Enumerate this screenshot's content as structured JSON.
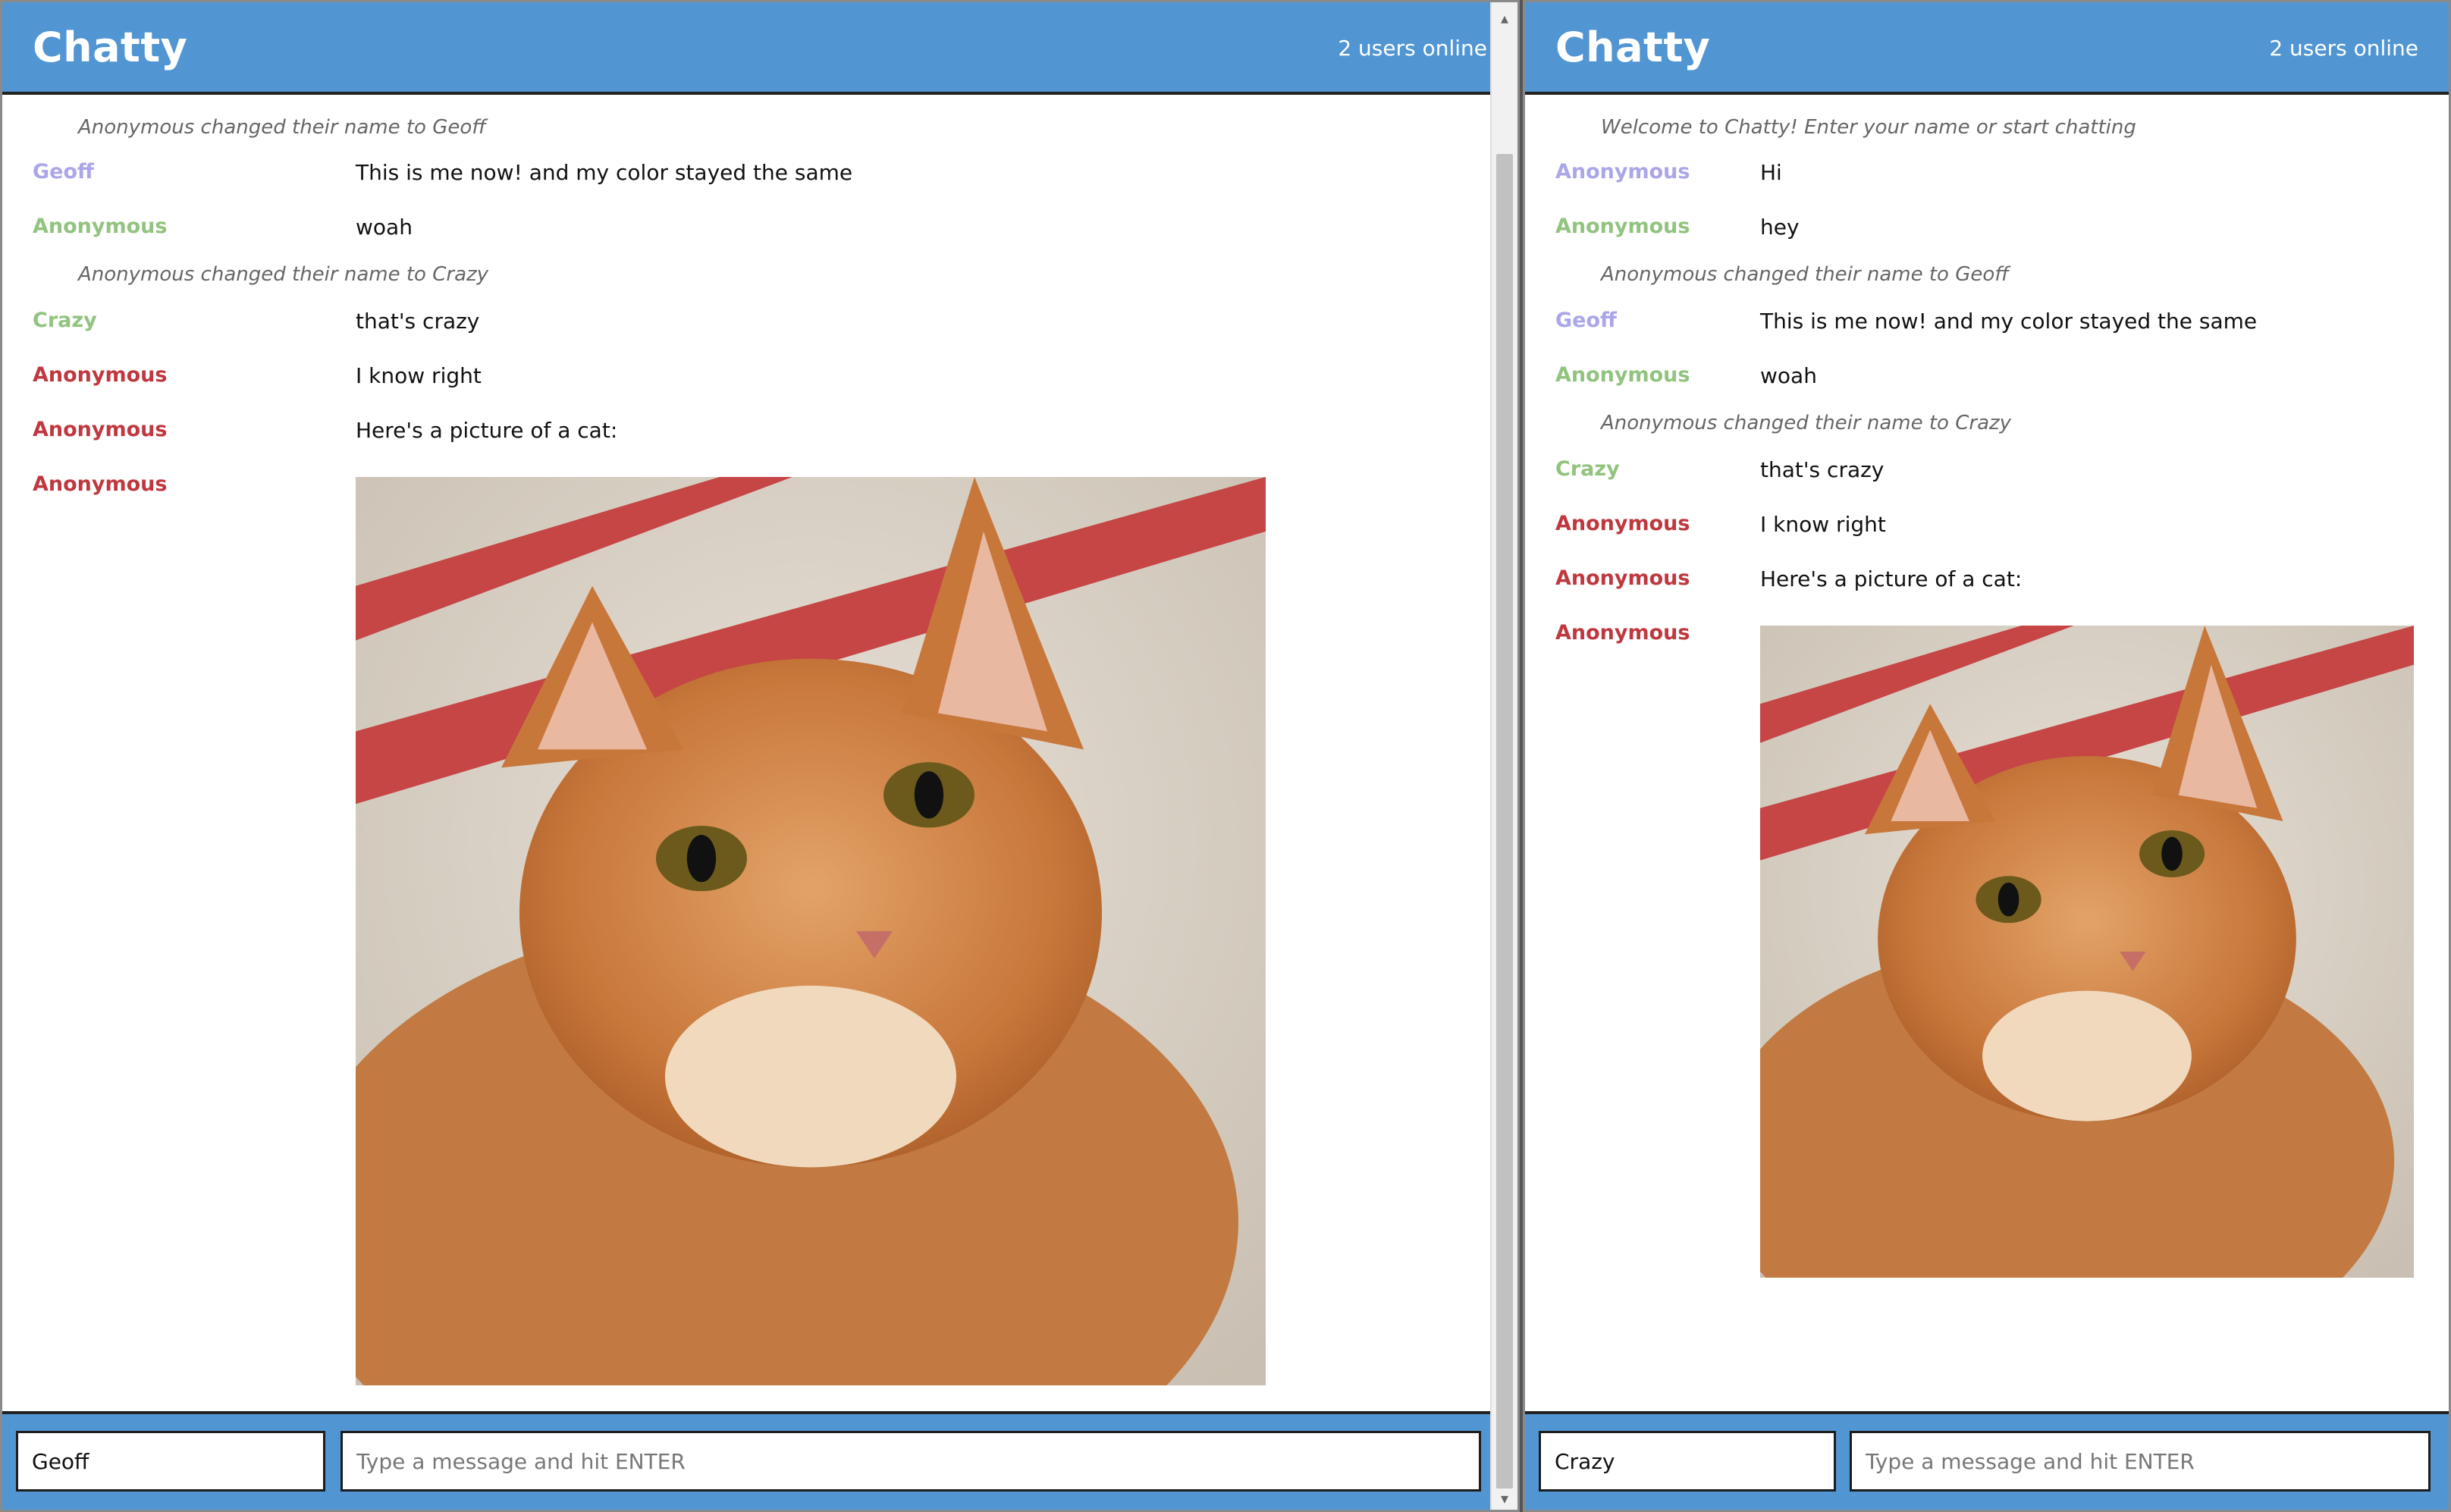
{
  "colors": {
    "header_bg": "#5196d3",
    "geoff": "#aaa6e8",
    "anonymous_green": "#92c37f",
    "anonymous_red": "#c0383f",
    "crazy": "#92c37f"
  },
  "left": {
    "title": "Chatty",
    "users_online": "2 users online",
    "messages": [
      {
        "type": "system",
        "text": "Anonymous changed their name to Geoff"
      },
      {
        "type": "user",
        "user": "Geoff",
        "color": "#aaa6e8",
        "text": "This is me now! and my color stayed the same"
      },
      {
        "type": "user",
        "user": "Anonymous",
        "color": "#92c37f",
        "text": "woah"
      },
      {
        "type": "system",
        "text": "Anonymous changed their name to Crazy"
      },
      {
        "type": "user",
        "user": "Crazy",
        "color": "#92c37f",
        "text": "that's crazy"
      },
      {
        "type": "user",
        "user": "Anonymous",
        "color": "#c0383f",
        "text": "I know right"
      },
      {
        "type": "user",
        "user": "Anonymous",
        "color": "#c0383f",
        "text": "Here's a picture of a cat:"
      },
      {
        "type": "image",
        "user": "Anonymous",
        "color": "#c0383f",
        "image": "orange-cat-photo"
      }
    ],
    "composer": {
      "name_value": "Geoff",
      "message_placeholder": "Type a message and hit ENTER"
    }
  },
  "right": {
    "title": "Chatty",
    "users_online": "2 users online",
    "messages": [
      {
        "type": "system",
        "text": "Welcome to Chatty! Enter your name or start chatting"
      },
      {
        "type": "user",
        "user": "Anonymous",
        "color": "#aaa6e8",
        "text": "Hi"
      },
      {
        "type": "user",
        "user": "Anonymous",
        "color": "#92c37f",
        "text": "hey"
      },
      {
        "type": "system",
        "text": "Anonymous changed their name to Geoff"
      },
      {
        "type": "user",
        "user": "Geoff",
        "color": "#aaa6e8",
        "text": "This is me now! and my color stayed the same"
      },
      {
        "type": "user",
        "user": "Anonymous",
        "color": "#92c37f",
        "text": "woah"
      },
      {
        "type": "system",
        "text": "Anonymous changed their name to Crazy"
      },
      {
        "type": "user",
        "user": "Crazy",
        "color": "#92c37f",
        "text": "that's crazy"
      },
      {
        "type": "user",
        "user": "Anonymous",
        "color": "#c0383f",
        "text": "I know right"
      },
      {
        "type": "user",
        "user": "Anonymous",
        "color": "#c0383f",
        "text": "Here's a picture of a cat:"
      },
      {
        "type": "image",
        "user": "Anonymous",
        "color": "#c0383f",
        "image": "orange-cat-photo"
      }
    ],
    "composer": {
      "name_value": "Crazy",
      "message_placeholder": "Type a message and hit ENTER"
    }
  }
}
